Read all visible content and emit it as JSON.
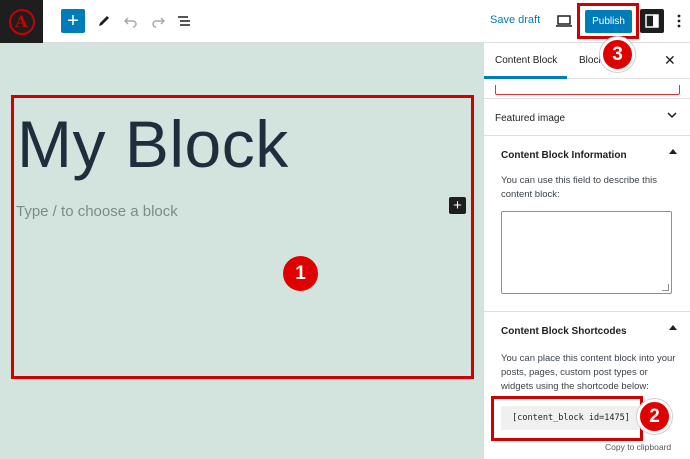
{
  "toolbar": {
    "logo_letter": "A",
    "add_icon": "plus-icon",
    "tools_icon": "pencil-icon",
    "undo_icon": "undo-icon",
    "redo_icon": "redo-icon",
    "listview_icon": "list-view-icon",
    "save_draft": "Save draft",
    "preview_icon": "desktop-icon",
    "publish": "Publish",
    "settings_icon": "sidebar-toggle-icon",
    "more_icon": "more-vertical-icon"
  },
  "canvas": {
    "title": "My Block",
    "placeholder": "Type / to choose a block",
    "inserter_icon": "plus-icon",
    "background": "#d3e4de"
  },
  "sidebar": {
    "tabs": [
      {
        "label": "Content Block",
        "active": true
      },
      {
        "label": "Block",
        "active": false
      }
    ],
    "close_icon": "close-icon",
    "panels": {
      "featured_image": {
        "title": "Featured image",
        "icon": "chevron-down-icon"
      },
      "info": {
        "title": "Content Block Information",
        "icon": "chevron-up-icon",
        "description": "You can use this field to describe this content block:",
        "textarea_value": ""
      },
      "shortcodes": {
        "title": "Content Block Shortcodes",
        "icon": "chevron-up-icon",
        "description": "You can place this content block into your posts, pages, custom post types or widgets using the shortcode below:",
        "shortcode": "[content_block id=1475]",
        "copy_label": "Copy to clipboard"
      }
    }
  },
  "annotations": {
    "badge_1": "1",
    "badge_2": "2",
    "badge_3": "3",
    "color": "#d10000"
  },
  "colors": {
    "accent": "#007cba",
    "dark": "#1e1e1e"
  }
}
